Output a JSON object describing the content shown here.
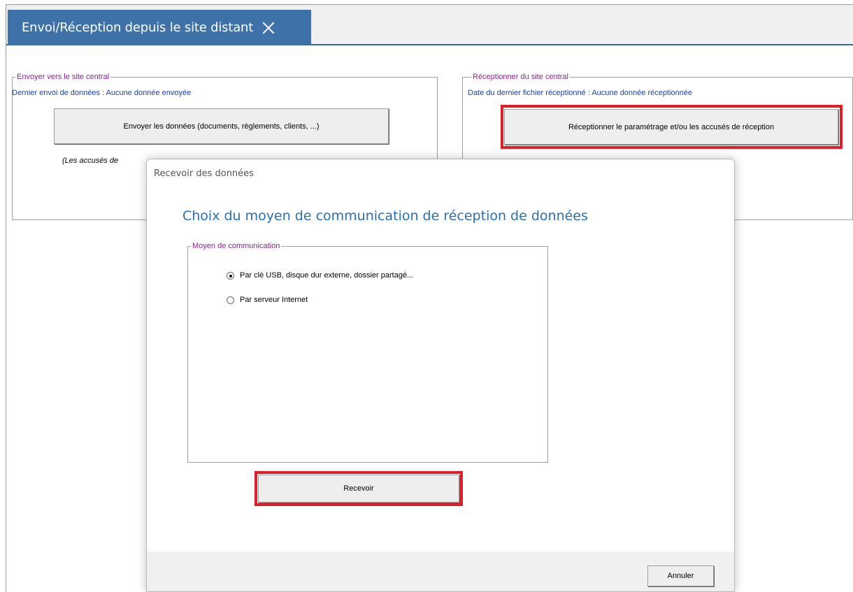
{
  "tab": {
    "title": "Envoi/Réception depuis le site distant"
  },
  "send_group": {
    "legend": "Envoyer vers le site central",
    "info": "Dernier envoi de données : Aucune donnée envoyée",
    "button_label": "Envoyer les données (documents, règlements, clients, ...)",
    "note_partial": "(Les accusés de"
  },
  "receive_group": {
    "legend": "Réceptionner du site central",
    "info": "Date du dernier fichier réceptionné : Aucune donnée réceptionnée",
    "button_label": "Réceptionner le paramétrage et/ou les accusés de réception"
  },
  "dialog": {
    "title": "Recevoir des données",
    "heading": "Choix du moyen de communication de réception de données",
    "comm_group_legend": "Moyen de communication",
    "options": [
      {
        "label": "Par clé USB, disque dur externe, dossier partagé...",
        "selected": true
      },
      {
        "label": "Par serveur Internet",
        "selected": false
      }
    ],
    "receive_button": "Recevoir",
    "cancel_button": "Annuler"
  },
  "colors": {
    "tab_bg": "#3e71a8",
    "legend_text": "#8b2291",
    "info_text": "#1f3fa3",
    "heading_text": "#2a6fb0",
    "highlight": "#e01e28"
  }
}
